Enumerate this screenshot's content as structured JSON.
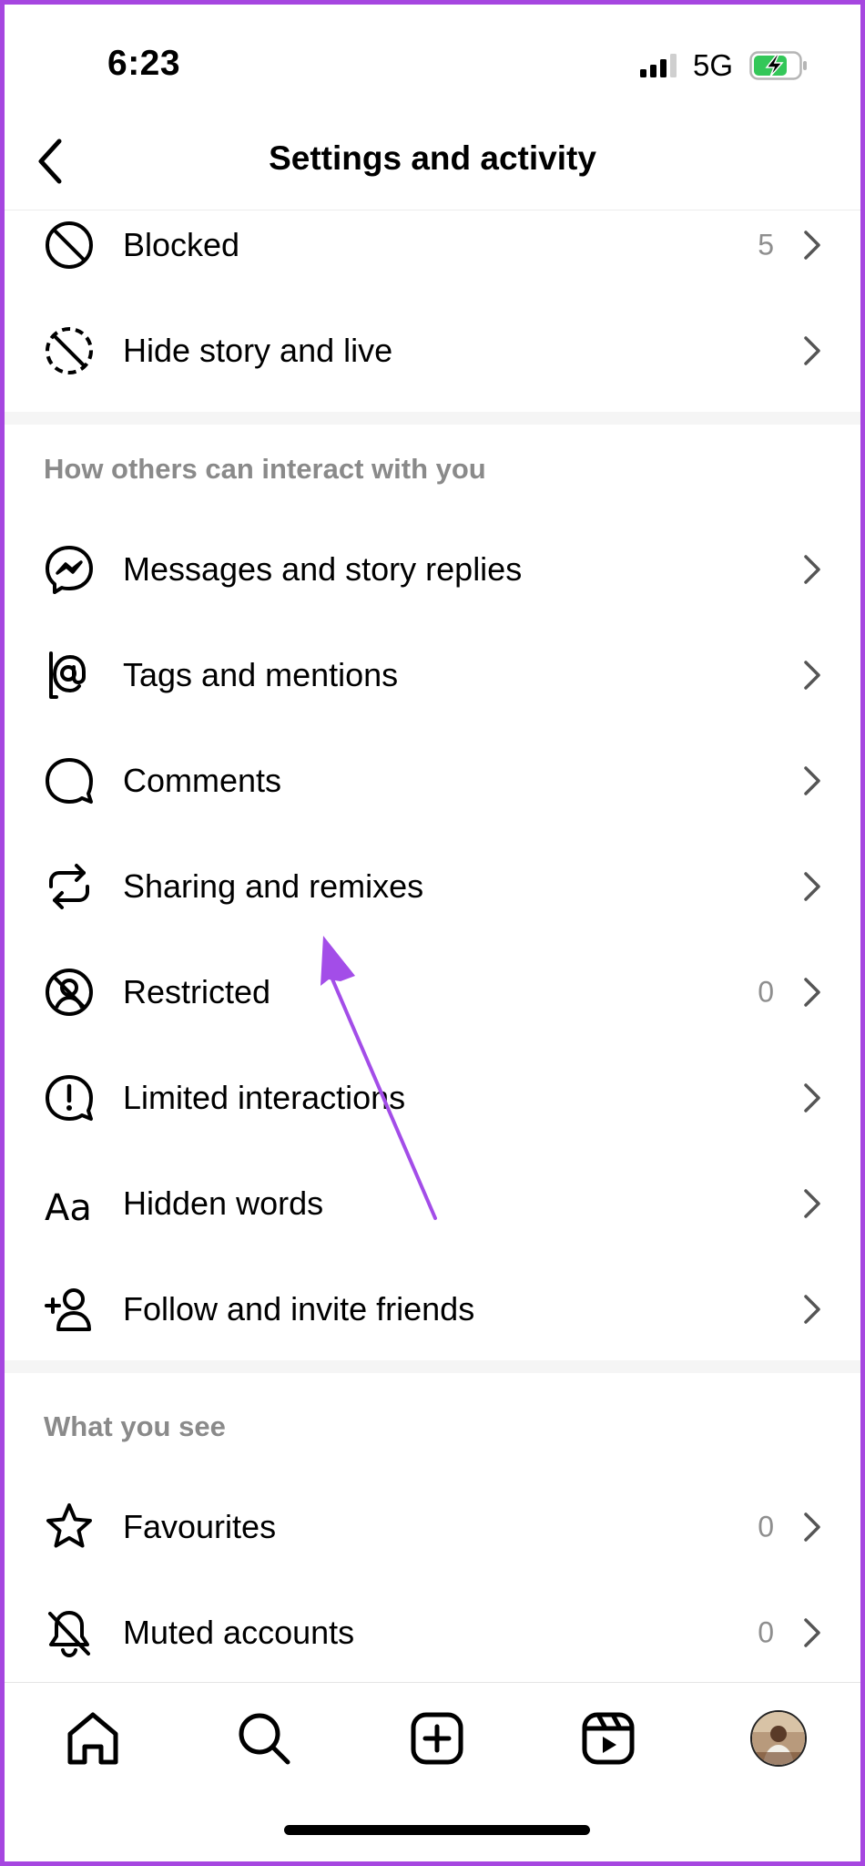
{
  "status_bar": {
    "time": "6:23",
    "network": "5G",
    "battery_color": "#34c759"
  },
  "nav": {
    "title": "Settings and activity"
  },
  "rows_top": [
    {
      "icon": "block-icon",
      "label": "Blocked",
      "count": "5"
    },
    {
      "icon": "hide-story-icon",
      "label": "Hide story and live",
      "count": ""
    }
  ],
  "section_interact": {
    "header": "How others can interact with you",
    "items": [
      {
        "icon": "messenger-icon",
        "label": "Messages and story replies",
        "count": ""
      },
      {
        "icon": "at-sign-icon",
        "label": "Tags and mentions",
        "count": ""
      },
      {
        "icon": "comment-icon",
        "label": "Comments",
        "count": ""
      },
      {
        "icon": "repost-icon",
        "label": "Sharing and remixes",
        "count": ""
      },
      {
        "icon": "restricted-icon",
        "label": "Restricted",
        "count": "0"
      },
      {
        "icon": "limited-interactions-icon",
        "label": "Limited interactions",
        "count": ""
      },
      {
        "icon": "hidden-words-icon",
        "label": "Hidden words",
        "count": ""
      },
      {
        "icon": "add-person-icon",
        "label": "Follow and invite friends",
        "count": ""
      }
    ]
  },
  "section_see": {
    "header": "What you see",
    "items": [
      {
        "icon": "star-icon",
        "label": "Favourites",
        "count": "0"
      },
      {
        "icon": "muted-bell-icon",
        "label": "Muted accounts",
        "count": "0"
      }
    ]
  },
  "tabbar": {
    "tabs": [
      "home-icon",
      "search-icon",
      "create-icon",
      "reels-icon",
      "profile-avatar"
    ]
  },
  "annotation": {
    "color": "#a34de8"
  }
}
